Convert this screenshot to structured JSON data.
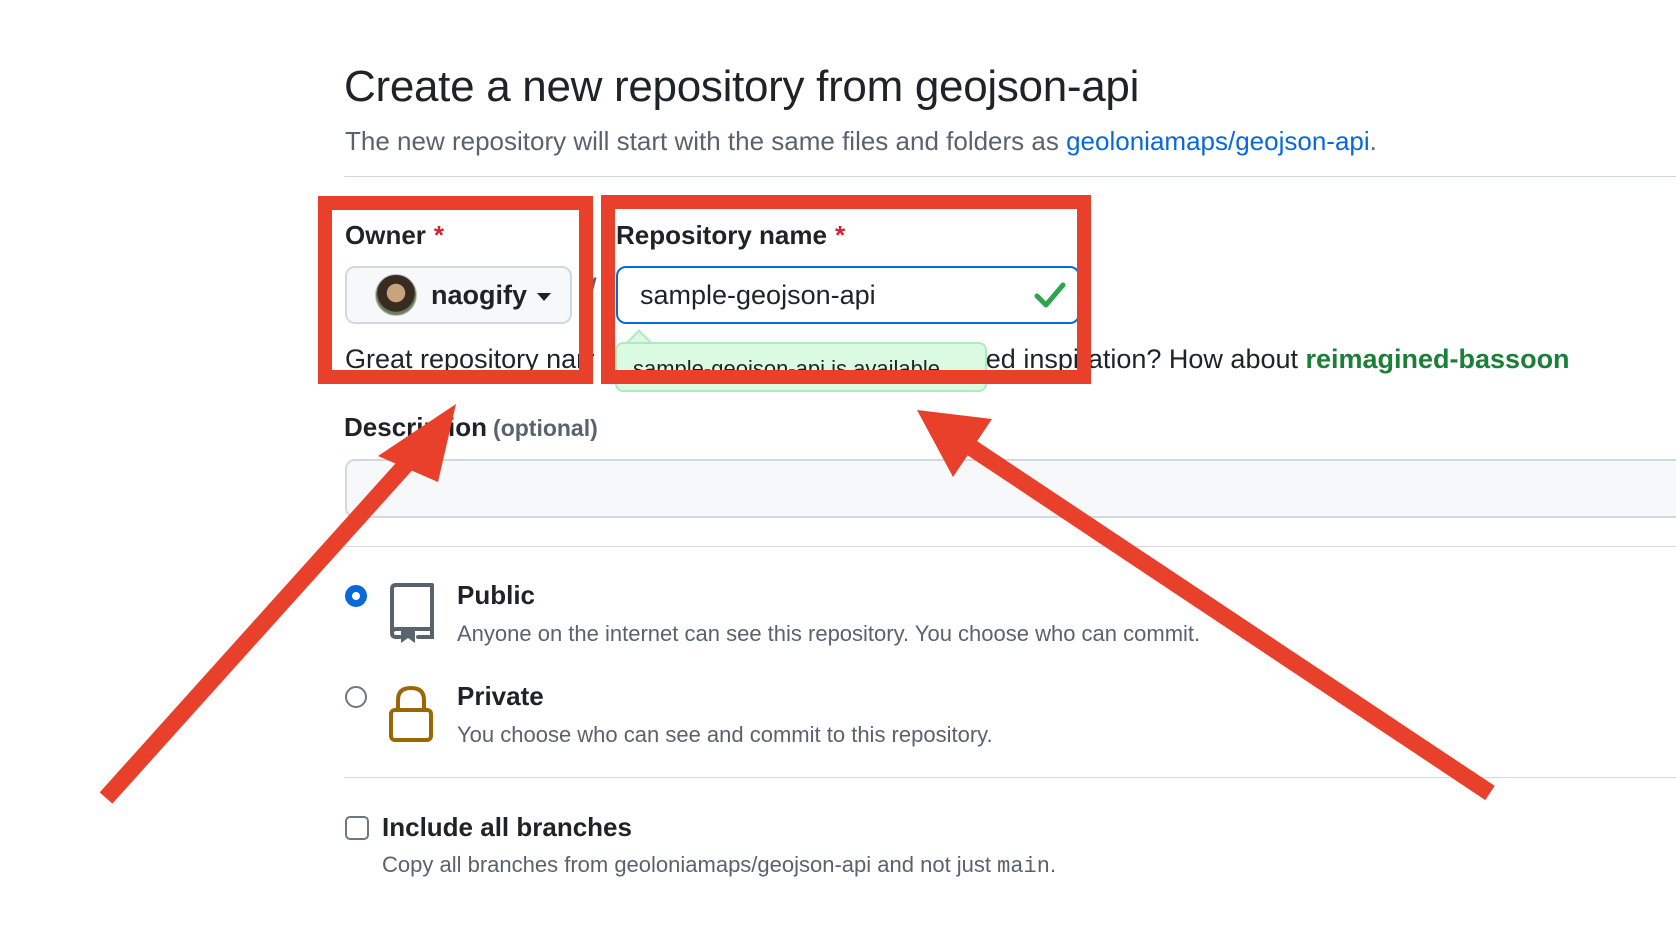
{
  "header": {
    "title": "Create a new repository from geojson-api",
    "subtitle_prefix": "The new repository will start with the same files and folders as ",
    "template_link": "geoloniamaps/geojson-api",
    "subtitle_suffix": "."
  },
  "owner": {
    "label": "Owner",
    "required_mark": "*",
    "value": "naogify"
  },
  "separator": "/",
  "repo_name": {
    "label": "Repository name",
    "required_mark": "*",
    "value": "sample-geojson-api",
    "availability": "sample-geojson-api is available."
  },
  "name_hint": {
    "prefix": "Great repository names are short and memorable. Need inspiration? How about ",
    "suggestion": "reimagined-bassoon"
  },
  "description": {
    "label": "Description",
    "optional": "(optional)",
    "value": ""
  },
  "visibility": {
    "public": {
      "title": "Public",
      "desc": "Anyone on the internet can see this repository. You choose who can commit.",
      "selected": true
    },
    "private": {
      "title": "Private",
      "desc": "You choose who can see and commit to this repository.",
      "selected": false
    }
  },
  "branches": {
    "label": "Include all branches",
    "desc_prefix": "Copy all branches from geoloniamaps/geojson-api and not just ",
    "desc_code": "main",
    "desc_suffix": ".",
    "checked": false
  },
  "annotation_color": "#e8402a",
  "accent_color": "#0969da",
  "success_color": "#1a7f37"
}
